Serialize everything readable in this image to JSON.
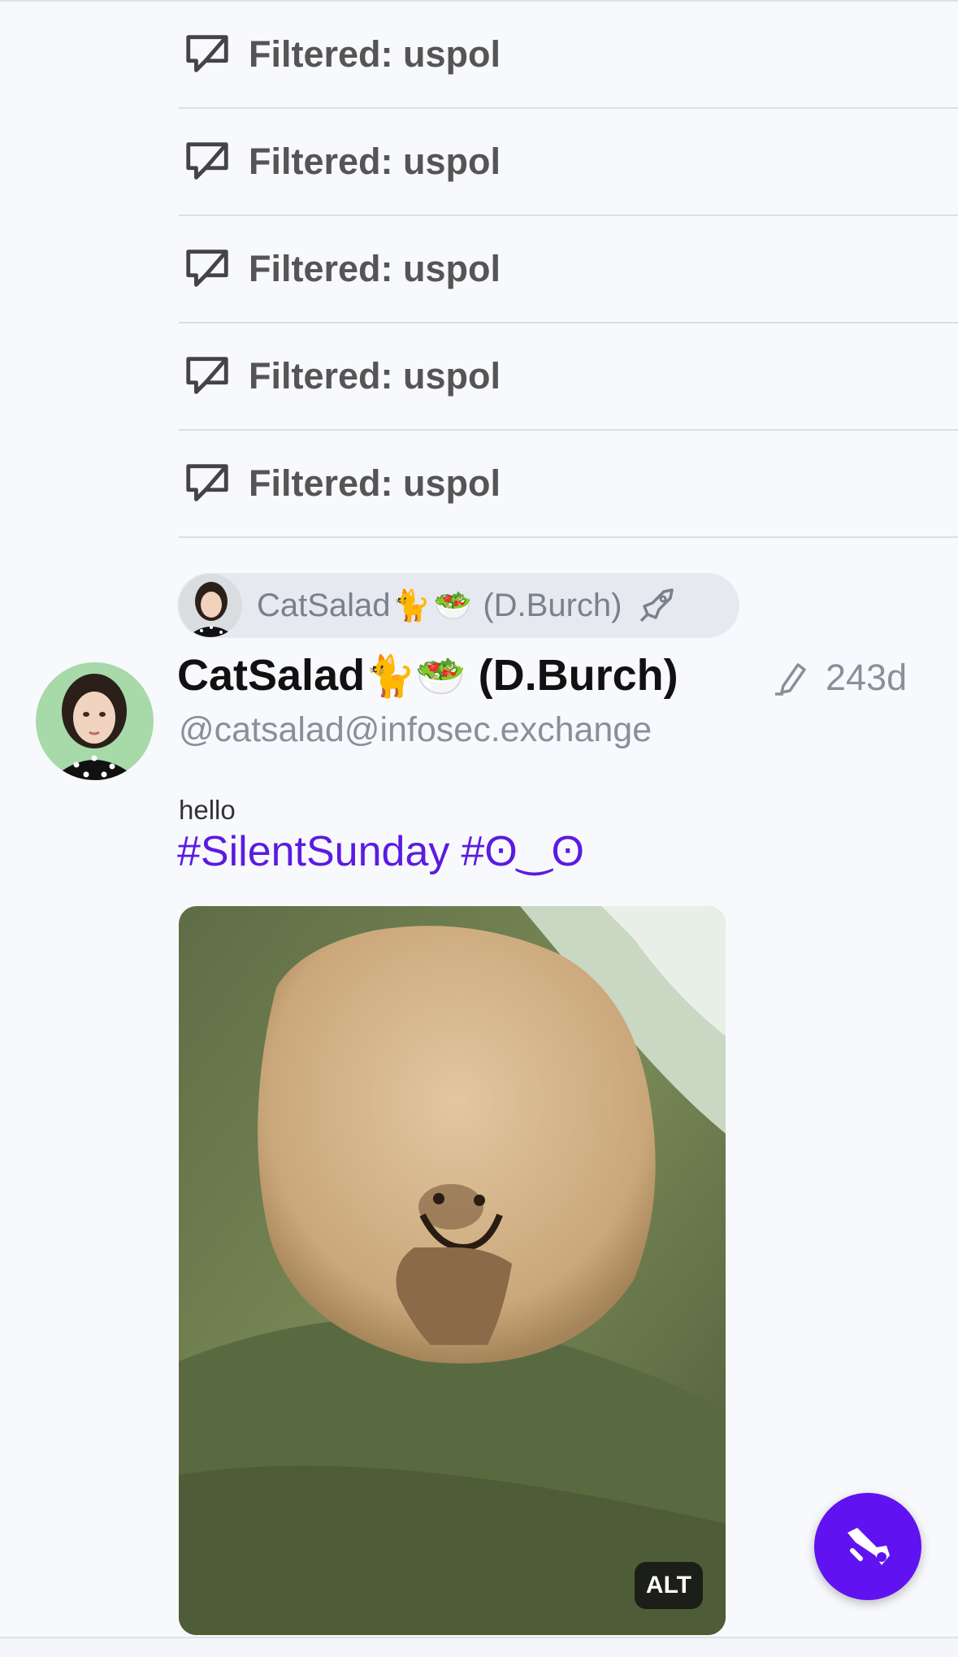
{
  "filtered_items": [
    {
      "label": "Filtered: uspol"
    },
    {
      "label": "Filtered: uspol"
    },
    {
      "label": "Filtered: uspol"
    },
    {
      "label": "Filtered: uspol"
    },
    {
      "label": "Filtered: uspol"
    }
  ],
  "boost": {
    "name": "CatSalad",
    "emoji_1": "🐈",
    "emoji_2": "🥗",
    "name_suffix": "(D.Burch)",
    "icon": "rocket-icon"
  },
  "post": {
    "display_name": "CatSalad",
    "emoji_1": "🐈",
    "emoji_2": "🥗",
    "display_name_suffix": "(D.Burch)",
    "handle": "@catsalad@infosec.exchange",
    "age": "243d",
    "text": "hello",
    "hashtags": [
      "#SilentSunday",
      "#ʘ‿ʘ"
    ],
    "media_alt_badge": "ALT"
  },
  "compose_button": {
    "icon": "trumpet-icon"
  },
  "colors": {
    "accent": "#6013f0",
    "hashtag": "#5b1be0",
    "background": "#f8f9fd"
  }
}
